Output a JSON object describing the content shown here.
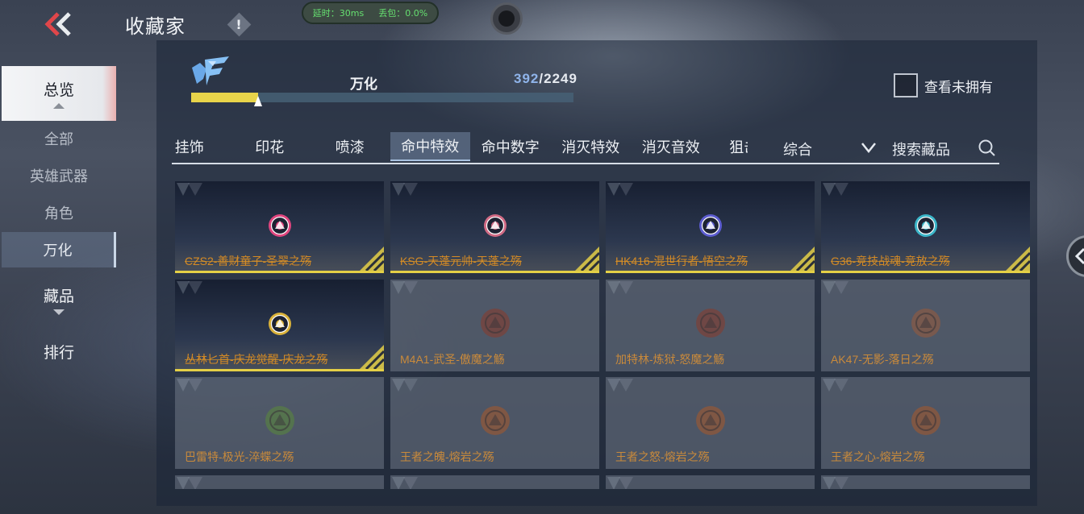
{
  "header": {
    "title": "收藏家",
    "info_icon": "!",
    "latency_label": "延时：30ms",
    "packet_loss_label": "丢包：0.0%"
  },
  "sidebar": {
    "overview": "总览",
    "sub_items": [
      {
        "label": "全部"
      },
      {
        "label": "英雄武器"
      },
      {
        "label": "角色"
      },
      {
        "label": "万化"
      }
    ],
    "collection": "藏品",
    "ranking": "排行"
  },
  "progress": {
    "label": "万化",
    "current": "392",
    "separator": "/",
    "total": "2249",
    "fill_fraction": 0.175
  },
  "owned_filter": {
    "label": "查看未拥有",
    "checked": false
  },
  "tabs": [
    "挂饰",
    "印花",
    "喷漆",
    "命中特效",
    "命中数字",
    "消灭特效",
    "消灭音效",
    "狙击枪"
  ],
  "active_tab_index": 3,
  "sort": {
    "label": "综合"
  },
  "search": {
    "label": "搜索藏品"
  },
  "items": [
    {
      "name": "CZS2-善财童子-圣翠之殇",
      "owned": true,
      "glyph_color": "#e0457e"
    },
    {
      "name": "KSG-天蓬元帅-天蓬之殇",
      "owned": true,
      "glyph_color": "#d06a84"
    },
    {
      "name": "HK416-混世行者-悟空之殇",
      "owned": true,
      "glyph_color": "#5c5cd0"
    },
    {
      "name": "G36-竞技战魂-竞放之殇",
      "owned": true,
      "glyph_color": "#3bb6c9"
    },
    {
      "name": "丛林匕首-庆龙觉醒-庆龙之殇",
      "owned": true,
      "glyph_color": "#d9b13a"
    },
    {
      "name": "M4A1-武圣-傲魔之觞",
      "owned": false,
      "glyph_color": "#8a3a2a"
    },
    {
      "name": "加特林-炼狱-怒魔之觞",
      "owned": false,
      "glyph_color": "#8a3a2a"
    },
    {
      "name": "AK47-无影-落日之殇",
      "owned": false,
      "glyph_color": "#9a5a3a"
    },
    {
      "name": "巴雷特-极光-淬蝶之殇",
      "owned": false,
      "glyph_color": "#5a8a3a"
    },
    {
      "name": "王者之魄-熔岩之殇",
      "owned": false,
      "glyph_color": "#a8582a"
    },
    {
      "name": "王者之怒-熔岩之殇",
      "owned": false,
      "glyph_color": "#a8582a"
    },
    {
      "name": "王者之心-熔岩之殇",
      "owned": false,
      "glyph_color": "#a8582a"
    },
    {
      "name": "",
      "owned": false,
      "glyph_color": ""
    },
    {
      "name": "",
      "owned": false,
      "glyph_color": ""
    },
    {
      "name": "",
      "owned": false,
      "glyph_color": ""
    },
    {
      "name": "",
      "owned": false,
      "glyph_color": ""
    }
  ],
  "icons": {
    "back": "double-chevron-left-icon",
    "logo": "cf-logo-icon",
    "sort": "chevron-down-icon",
    "search": "search-icon",
    "edge": "chevron-left-icon"
  },
  "colors": {
    "accent_yellow": "#e8d44a",
    "item_name_orange": "#d58a24",
    "progress_current": "#8fb4ea"
  }
}
